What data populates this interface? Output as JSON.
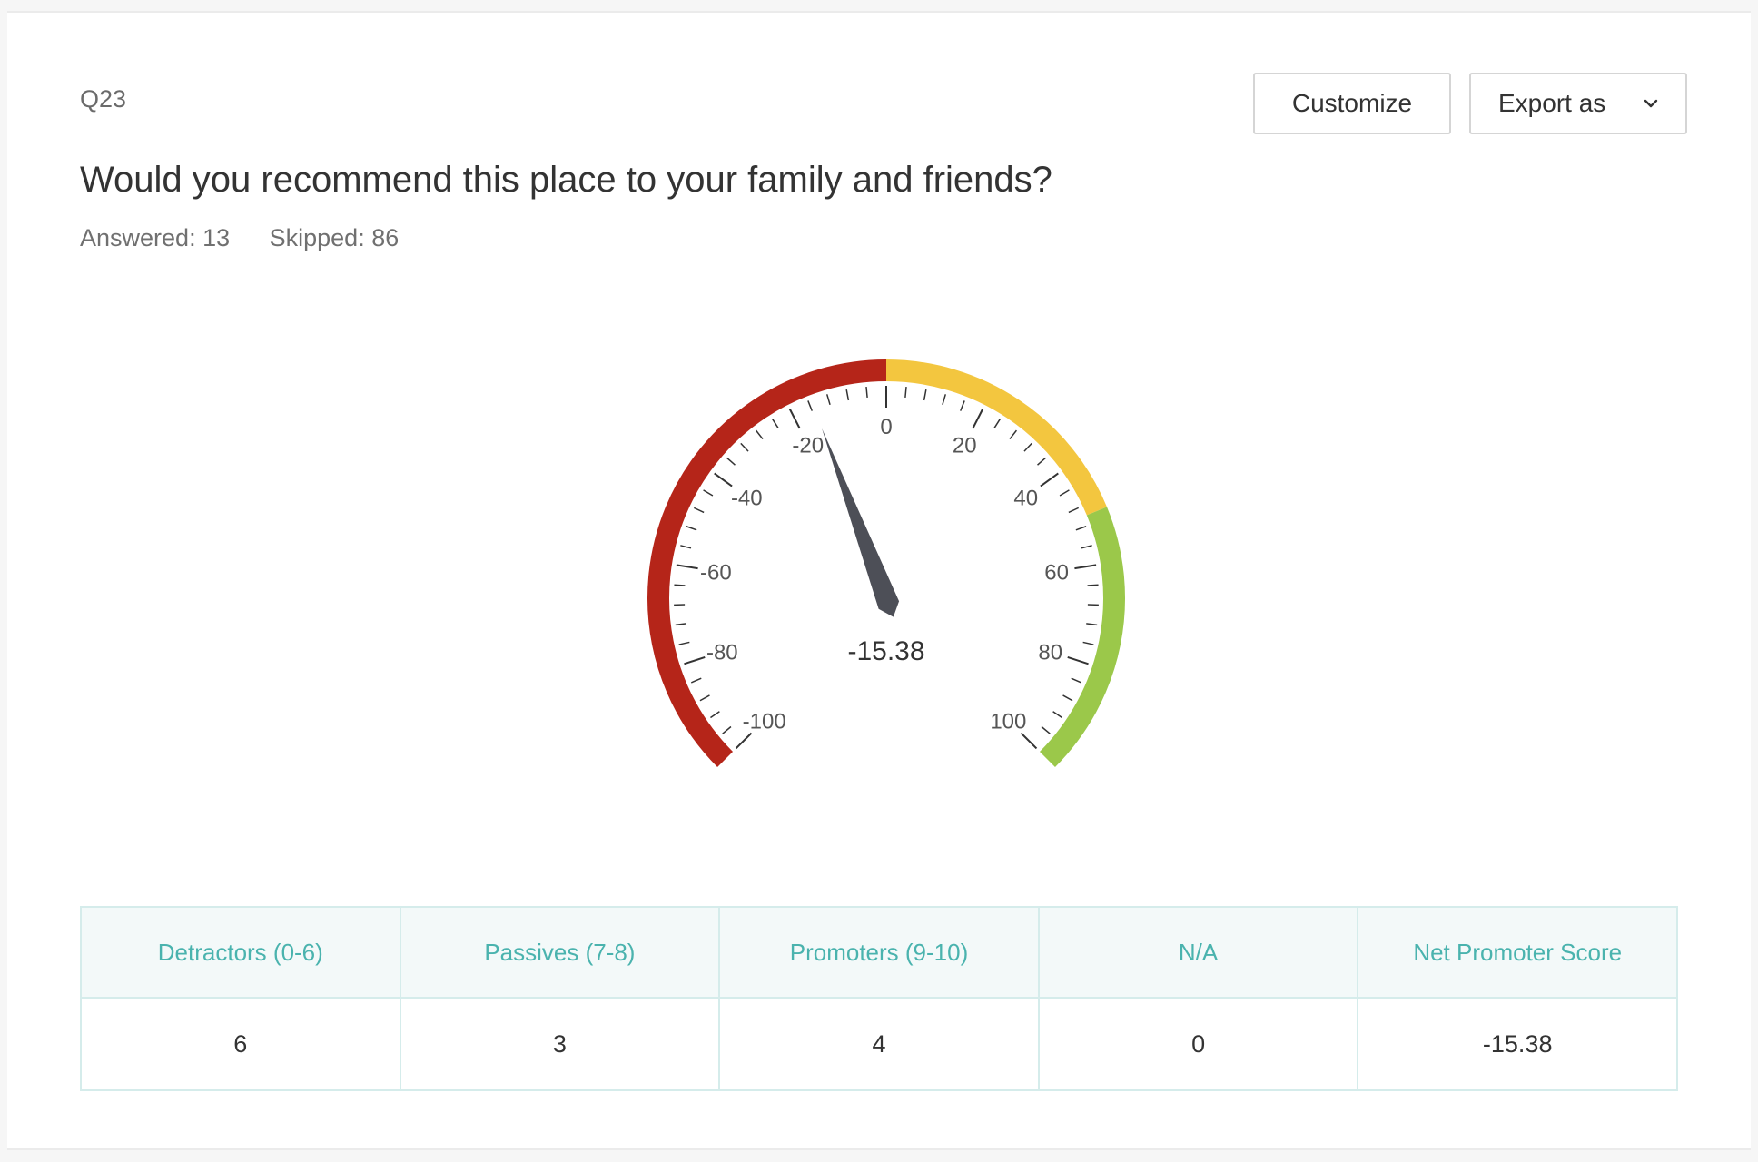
{
  "question": {
    "id": "Q23",
    "text": "Would you recommend this place to your family and friends?",
    "answered": "Answered: 13",
    "skipped": "Skipped: 86"
  },
  "toolbar": {
    "customize_label": "Customize",
    "export_label": "Export as"
  },
  "chart_data": {
    "type": "gauge",
    "value": -15.38,
    "value_label": "-15.38",
    "min": -100,
    "max": 100,
    "major_ticks": [
      -100,
      -80,
      -60,
      -40,
      -20,
      0,
      20,
      40,
      60,
      80,
      100
    ],
    "bands": [
      {
        "from": -100,
        "to": 0,
        "color": "#b52519"
      },
      {
        "from": 0,
        "to": 50,
        "color": "#f3c63f"
      },
      {
        "from": 50,
        "to": 100,
        "color": "#9bc84a"
      }
    ],
    "needle_color": "#4d4f57"
  },
  "table": {
    "headers": [
      "Detractors (0-6)",
      "Passives (7-8)",
      "Promoters (9-10)",
      "N/A",
      "Net Promoter Score"
    ],
    "values": [
      "6",
      "3",
      "4",
      "0",
      "-15.38"
    ]
  }
}
